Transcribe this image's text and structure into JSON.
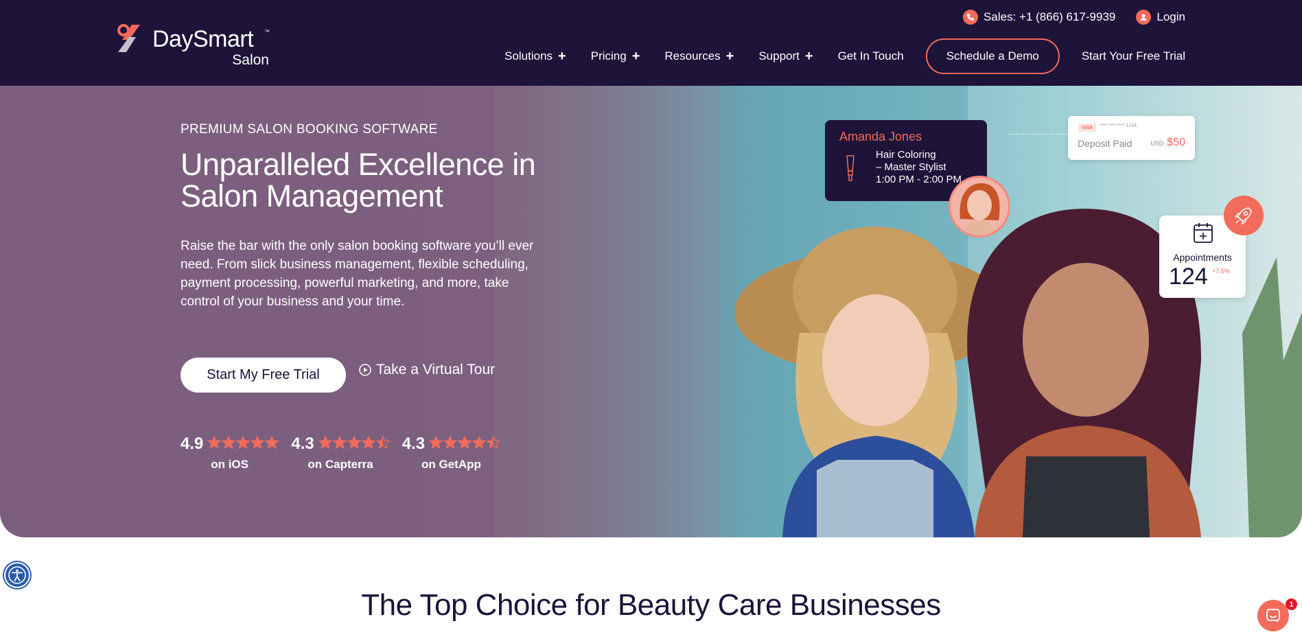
{
  "colors": {
    "nav_bg": "#1e1339",
    "accent": "#f26b5b",
    "hero_tint": "#7c5f7e"
  },
  "brand": {
    "name": "DaySmart",
    "trademark": "™",
    "sub": "Salon"
  },
  "utility": {
    "sales": "Sales: +1 (866) 617-9939",
    "login": "Login"
  },
  "menu": {
    "items": [
      "Solutions",
      "Pricing",
      "Resources",
      "Support"
    ],
    "contact": "Get In Touch",
    "demo": "Schedule a Demo",
    "trial": "Start Your Free Trial"
  },
  "hero": {
    "eyebrow": "PREMIUM SALON BOOKING SOFTWARE",
    "headline": "Unparalleled Excellence in Salon Management",
    "lead": "Raise the bar with the only salon booking software you’ll ever need. From slick business management, flexible scheduling, payment processing, powerful marketing, and more, take control of your business and your time.",
    "cta_primary": "Start My Free Trial",
    "cta_tour": "Take a Virtual Tour"
  },
  "ratings": [
    {
      "score": "4.9",
      "source": "on iOS",
      "stars": 5
    },
    {
      "score": "4.3",
      "source": "on Capterra",
      "stars": 4.5
    },
    {
      "score": "4.3",
      "source": "on GetApp",
      "stars": 4.5
    }
  ],
  "appointment": {
    "name": "Amanda Jones",
    "line1": "Hair Coloring",
    "line2": "– Master Stylist",
    "time": "1:00 PM - 2:00 PM"
  },
  "payment": {
    "card_brand": "VISA",
    "card_number": "**** **** **** 1234",
    "label": "Deposit Paid",
    "currency": "USD",
    "amount": "$50"
  },
  "stats": {
    "label": "Appointments",
    "value": "124",
    "delta": "+7.5%"
  },
  "section": {
    "title": "The Top Choice for Beauty Care Businesses"
  },
  "chat": {
    "badge": "1"
  }
}
